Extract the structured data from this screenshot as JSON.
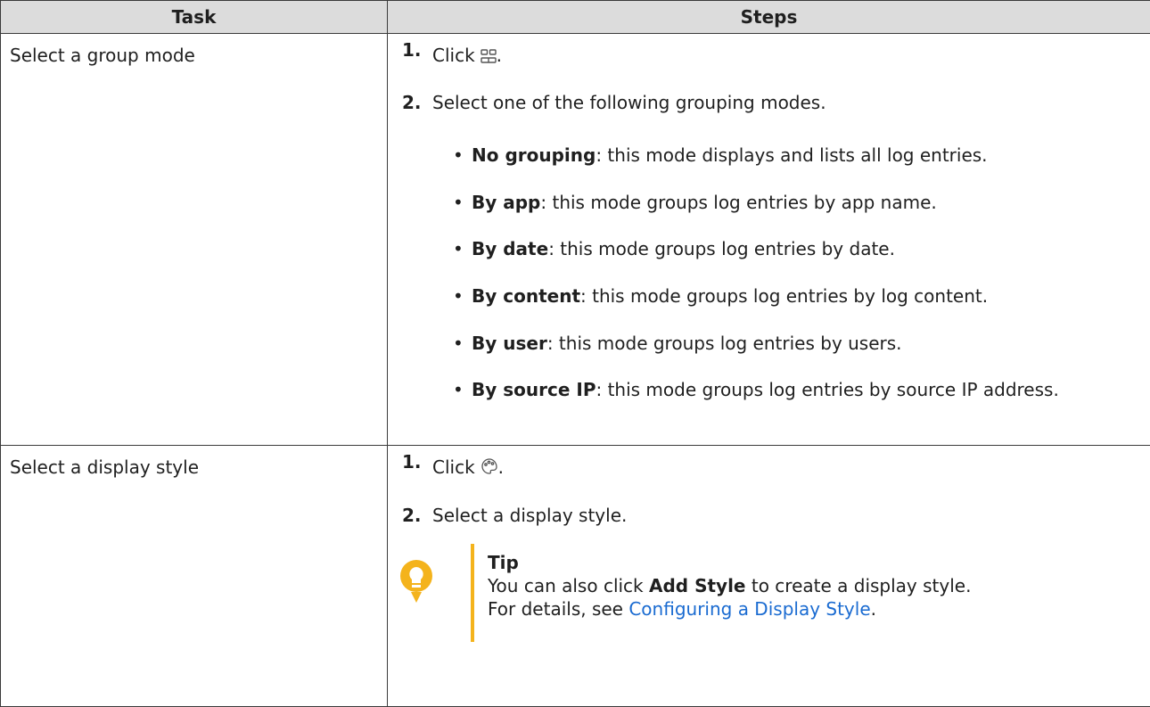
{
  "table": {
    "headers": {
      "task": "Task",
      "steps": "Steps"
    },
    "rows": [
      {
        "task": "Select a group mode",
        "steps": [
          {
            "number": "1.",
            "text_before": "Click",
            "icon": "grid-view-icon",
            "text_after": "."
          },
          {
            "number": "2.",
            "text": "Select one of the following grouping modes."
          }
        ],
        "bullets": [
          {
            "bold": "No grouping",
            "text": ": this mode displays and lists all log entries."
          },
          {
            "bold": "By app",
            "text": ": this mode groups log entries by app name."
          },
          {
            "bold": "By date",
            "text": ": this mode groups log entries by date."
          },
          {
            "bold": "By content",
            "text": ": this mode groups log entries by log content."
          },
          {
            "bold": "By user",
            "text": ": this mode groups log entries by users."
          },
          {
            "bold": "By source IP",
            "text": ": this mode groups log entries by source IP address."
          }
        ]
      },
      {
        "task": "Select a display style",
        "steps": [
          {
            "number": "1.",
            "text_before": "Click",
            "icon": "palette-icon",
            "text_after": "."
          },
          {
            "number": "2.",
            "text": "Select a display style."
          }
        ],
        "tip": {
          "icon": "lightbulb-icon",
          "title": "Tip",
          "line1_before": "You can also click ",
          "line1_bold": "Add Style",
          "line1_after": " to create a display style.",
          "line2_before": "For details, see ",
          "line2_link": "Configuring a Display Style",
          "line2_after": "."
        }
      }
    ]
  },
  "colors": {
    "header_bg": "#dcdcdc",
    "border": "#3a3a3a",
    "tip_accent": "#f4b31c",
    "link": "#1a6bd1"
  }
}
